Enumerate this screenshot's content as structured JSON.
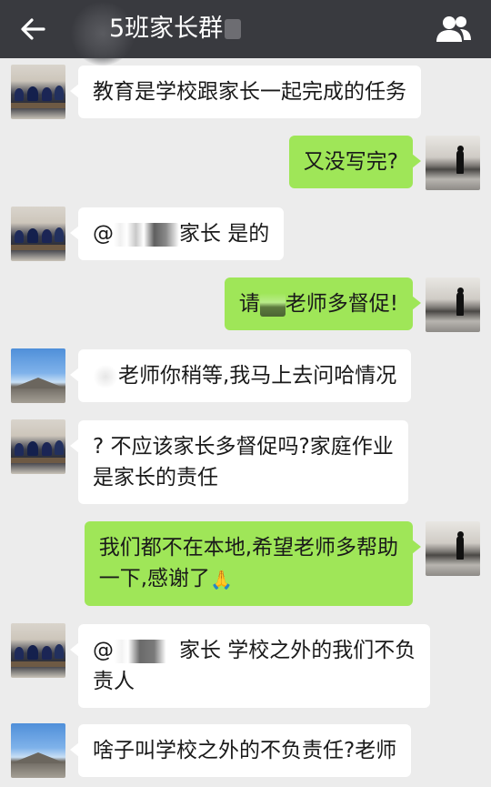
{
  "header": {
    "back_icon": "arrow-left-icon",
    "title": "5班家长群",
    "members_icon": "group-members-icon",
    "background": "#393a3f"
  },
  "colors": {
    "incoming_bubble": "#ffffff",
    "outgoing_bubble": "#9fe658",
    "chat_background": "#ececec"
  },
  "messages": [
    {
      "side": "left",
      "avatar": "classroom-avatar",
      "text": "教育是学校跟家长一起完成的任务"
    },
    {
      "side": "right",
      "avatar": "lake-silhouette-avatar",
      "text": "又没写完?"
    },
    {
      "side": "left",
      "avatar": "classroom-avatar",
      "text_prefix": "@",
      "text_suffix": "家长 是的"
    },
    {
      "side": "right",
      "avatar": "lake-silhouette-avatar",
      "text_prefix": "请",
      "text_suffix": "老师多督促!"
    },
    {
      "side": "left",
      "avatar": "sky-landscape-avatar",
      "text": "老师你稍等,我马上去问哈情况"
    },
    {
      "side": "left",
      "avatar": "classroom-avatar",
      "line1": "? 不应该家长多督促吗?家庭作业",
      "line2": "是家长的责任"
    },
    {
      "side": "right",
      "avatar": "lake-silhouette-avatar",
      "line1": "我们都不在本地,希望老师多帮助",
      "line2": "一下,感谢了",
      "emoji": "praying-hands-emoji"
    },
    {
      "side": "left",
      "avatar": "classroom-avatar",
      "line1_prefix": "@",
      "line1_suffix": "家长 学校之外的我们不负",
      "line2": "责人"
    },
    {
      "side": "left",
      "avatar": "sky-landscape-avatar",
      "text": "啥子叫学校之外的不负责任?老师"
    }
  ]
}
